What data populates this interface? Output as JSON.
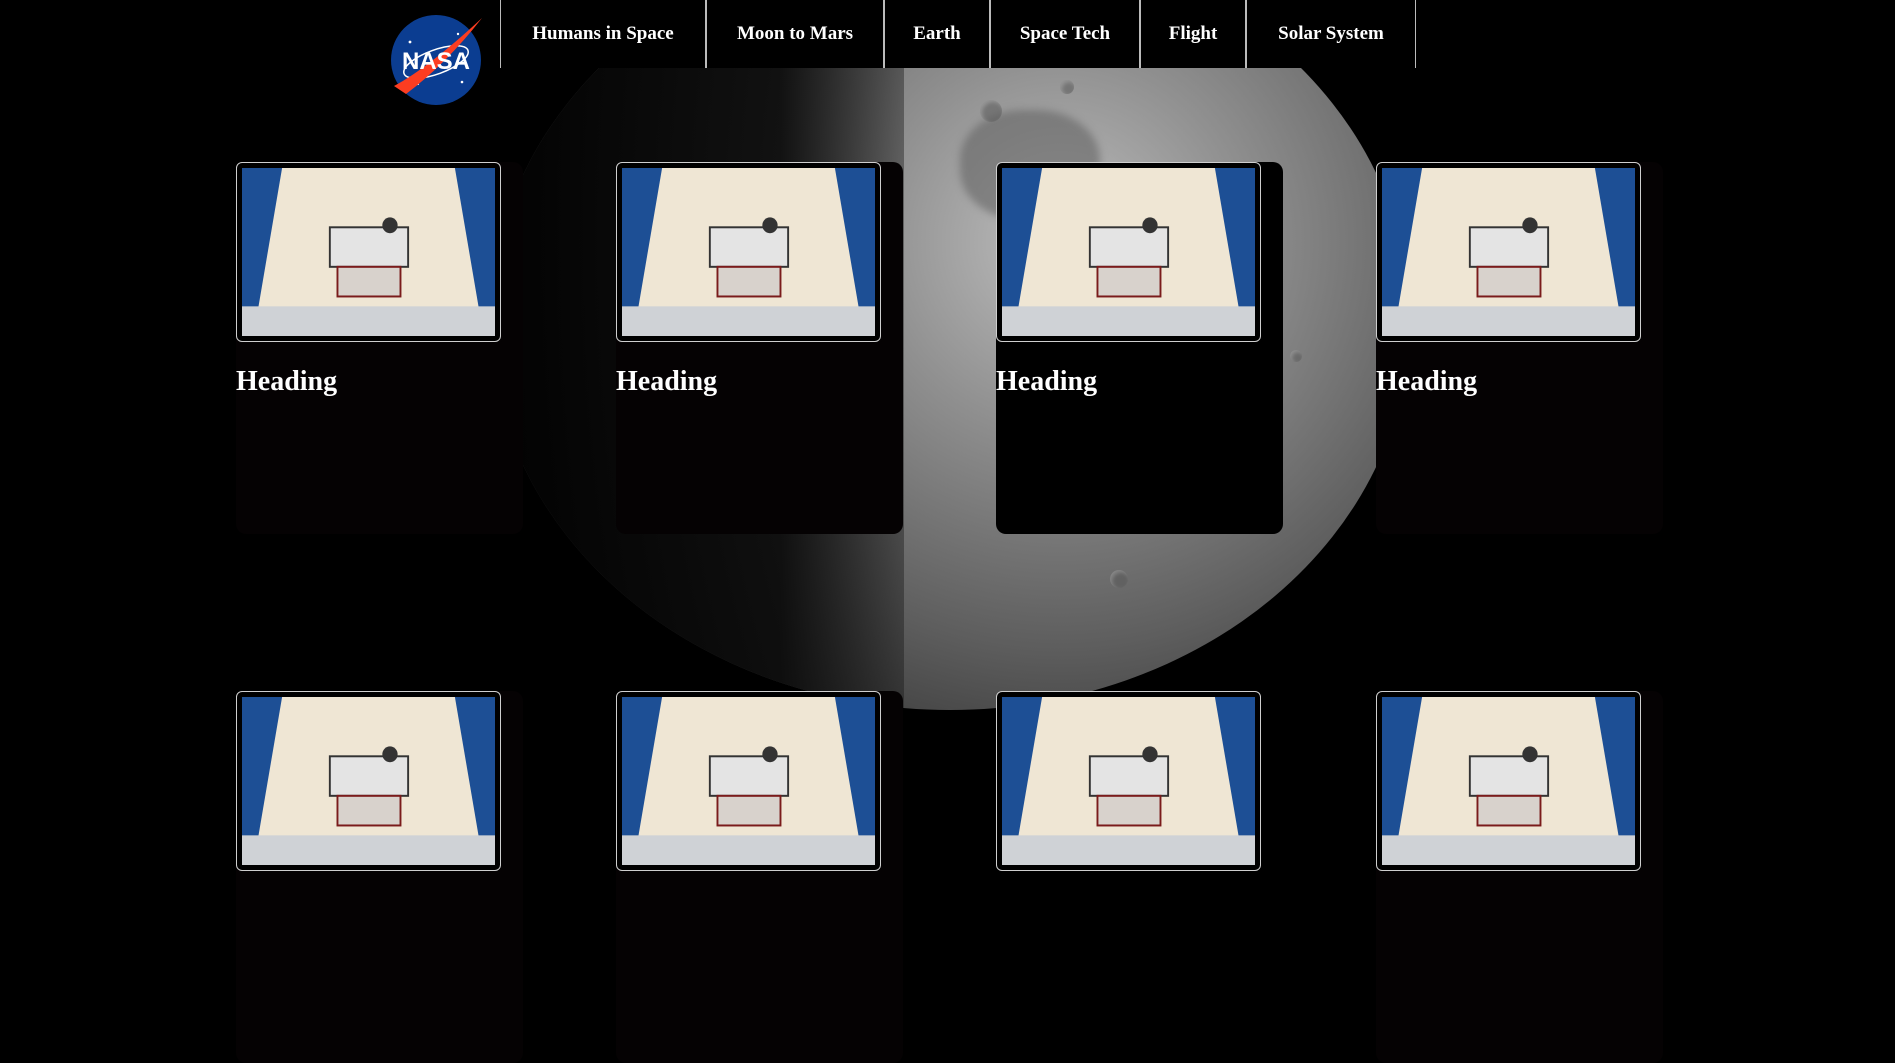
{
  "nav": {
    "logo_text": "NASA",
    "items": [
      {
        "label": "Humans in Space"
      },
      {
        "label": "Moon to Mars"
      },
      {
        "label": "Earth"
      },
      {
        "label": "Space Tech"
      },
      {
        "label": "Flight"
      },
      {
        "label": "Solar System"
      }
    ]
  },
  "cards": [
    {
      "heading": "Heading"
    },
    {
      "heading": "Heading"
    },
    {
      "heading": "Heading"
    },
    {
      "heading": "Heading"
    },
    {
      "heading": ""
    },
    {
      "heading": ""
    },
    {
      "heading": ""
    },
    {
      "heading": ""
    }
  ],
  "colors": {
    "background": "#000000",
    "nasa_blue": "#0b3d91",
    "nasa_red": "#fc3d21",
    "card_bg": "#050203"
  }
}
